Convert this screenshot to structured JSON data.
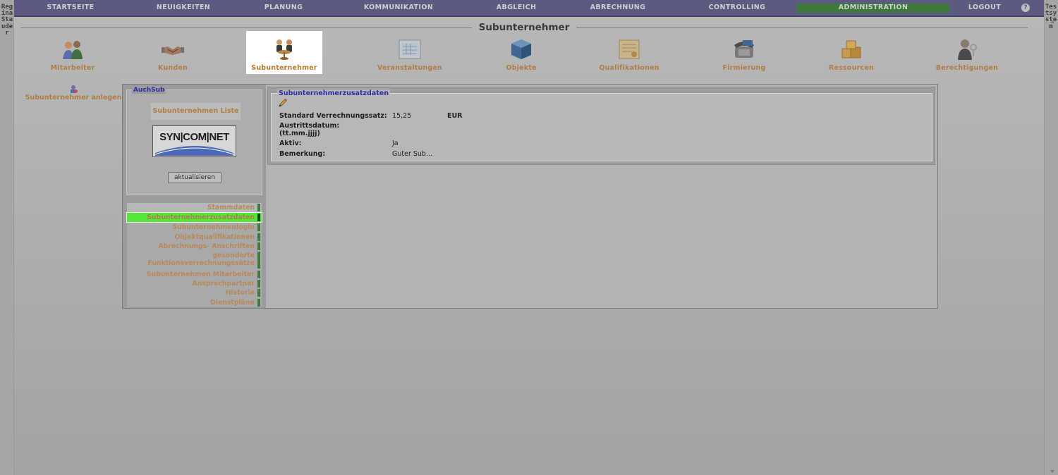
{
  "left_strip": {
    "vertical_text": "Regina Stauder"
  },
  "right_strip": {
    "vertical_text": "Testsystem"
  },
  "topnav": {
    "items": [
      {
        "label": "STARTSEITE"
      },
      {
        "label": "NEUIGKEITEN"
      },
      {
        "label": "PLANUNG"
      },
      {
        "label": "KOMMUNIKATION"
      },
      {
        "label": "ABGLEICH"
      },
      {
        "label": "ABRECHNUNG"
      },
      {
        "label": "CONTROLLING"
      },
      {
        "label": "ADMINISTRATION",
        "active": true
      },
      {
        "label": "LOGOUT"
      }
    ],
    "help_icon": "question-icon",
    "active_color": "#3c7a3c"
  },
  "page": {
    "title": "Subunternehmer"
  },
  "modules": [
    {
      "label": "Mitarbeiter",
      "icon": "users-icon"
    },
    {
      "label": "Kunden",
      "icon": "handshake-icon"
    },
    {
      "label": "Subunternehmer",
      "icon": "subcontractor-icon",
      "active": true
    },
    {
      "label": "Veranstaltungen",
      "icon": "calendar-grid-icon"
    },
    {
      "label": "Objekte",
      "icon": "cube-icon"
    },
    {
      "label": "Qualifikationen",
      "icon": "certificate-icon"
    },
    {
      "label": "Firmierung",
      "icon": "telephone-icon"
    },
    {
      "label": "Ressourcen",
      "icon": "boxes-icon"
    },
    {
      "label": "Berechtigungen",
      "icon": "person-key-icon"
    }
  ],
  "side_actions": {
    "new_subcontractor": "Subunternehmer anlegen"
  },
  "left_panel": {
    "legend": "AuchSub",
    "list_button": "Subunternehmen Liste",
    "logo_text": "SYN|COM|NET",
    "refresh_button": "aktualisieren",
    "tabs": [
      {
        "label": "Stammdaten"
      },
      {
        "label": "Subunternehmerzusatzdaten",
        "active": true
      },
      {
        "label": "Subunternehmenlogin"
      },
      {
        "label": "Objektqualifikationen"
      },
      {
        "label": "Abrechnungs- Anschriften"
      },
      {
        "label_line1": "gesonderte",
        "label_line2": "Funktionsverrechnungssätze"
      },
      {
        "label": "Subunternehmen Mitarbeiter"
      },
      {
        "label": "Ansprechpartner"
      },
      {
        "label": "Historie"
      },
      {
        "label": "Dienstpläne"
      }
    ]
  },
  "details": {
    "legend": "Subunternehmerzusatzdaten",
    "edit_icon": "pencil-icon",
    "fields": {
      "rate_label": "Standard Verrechnungssatz:",
      "rate_value": "15,25",
      "rate_unit": "EUR",
      "exit_label_line1": "Austrittsdatum:",
      "exit_label_line2": "(tt.mm.jjjj)",
      "exit_value": "",
      "active_label": "Aktiv:",
      "active_value": "Ja",
      "note_label": "Bemerkung:",
      "note_value": "Guter Sub..."
    }
  }
}
